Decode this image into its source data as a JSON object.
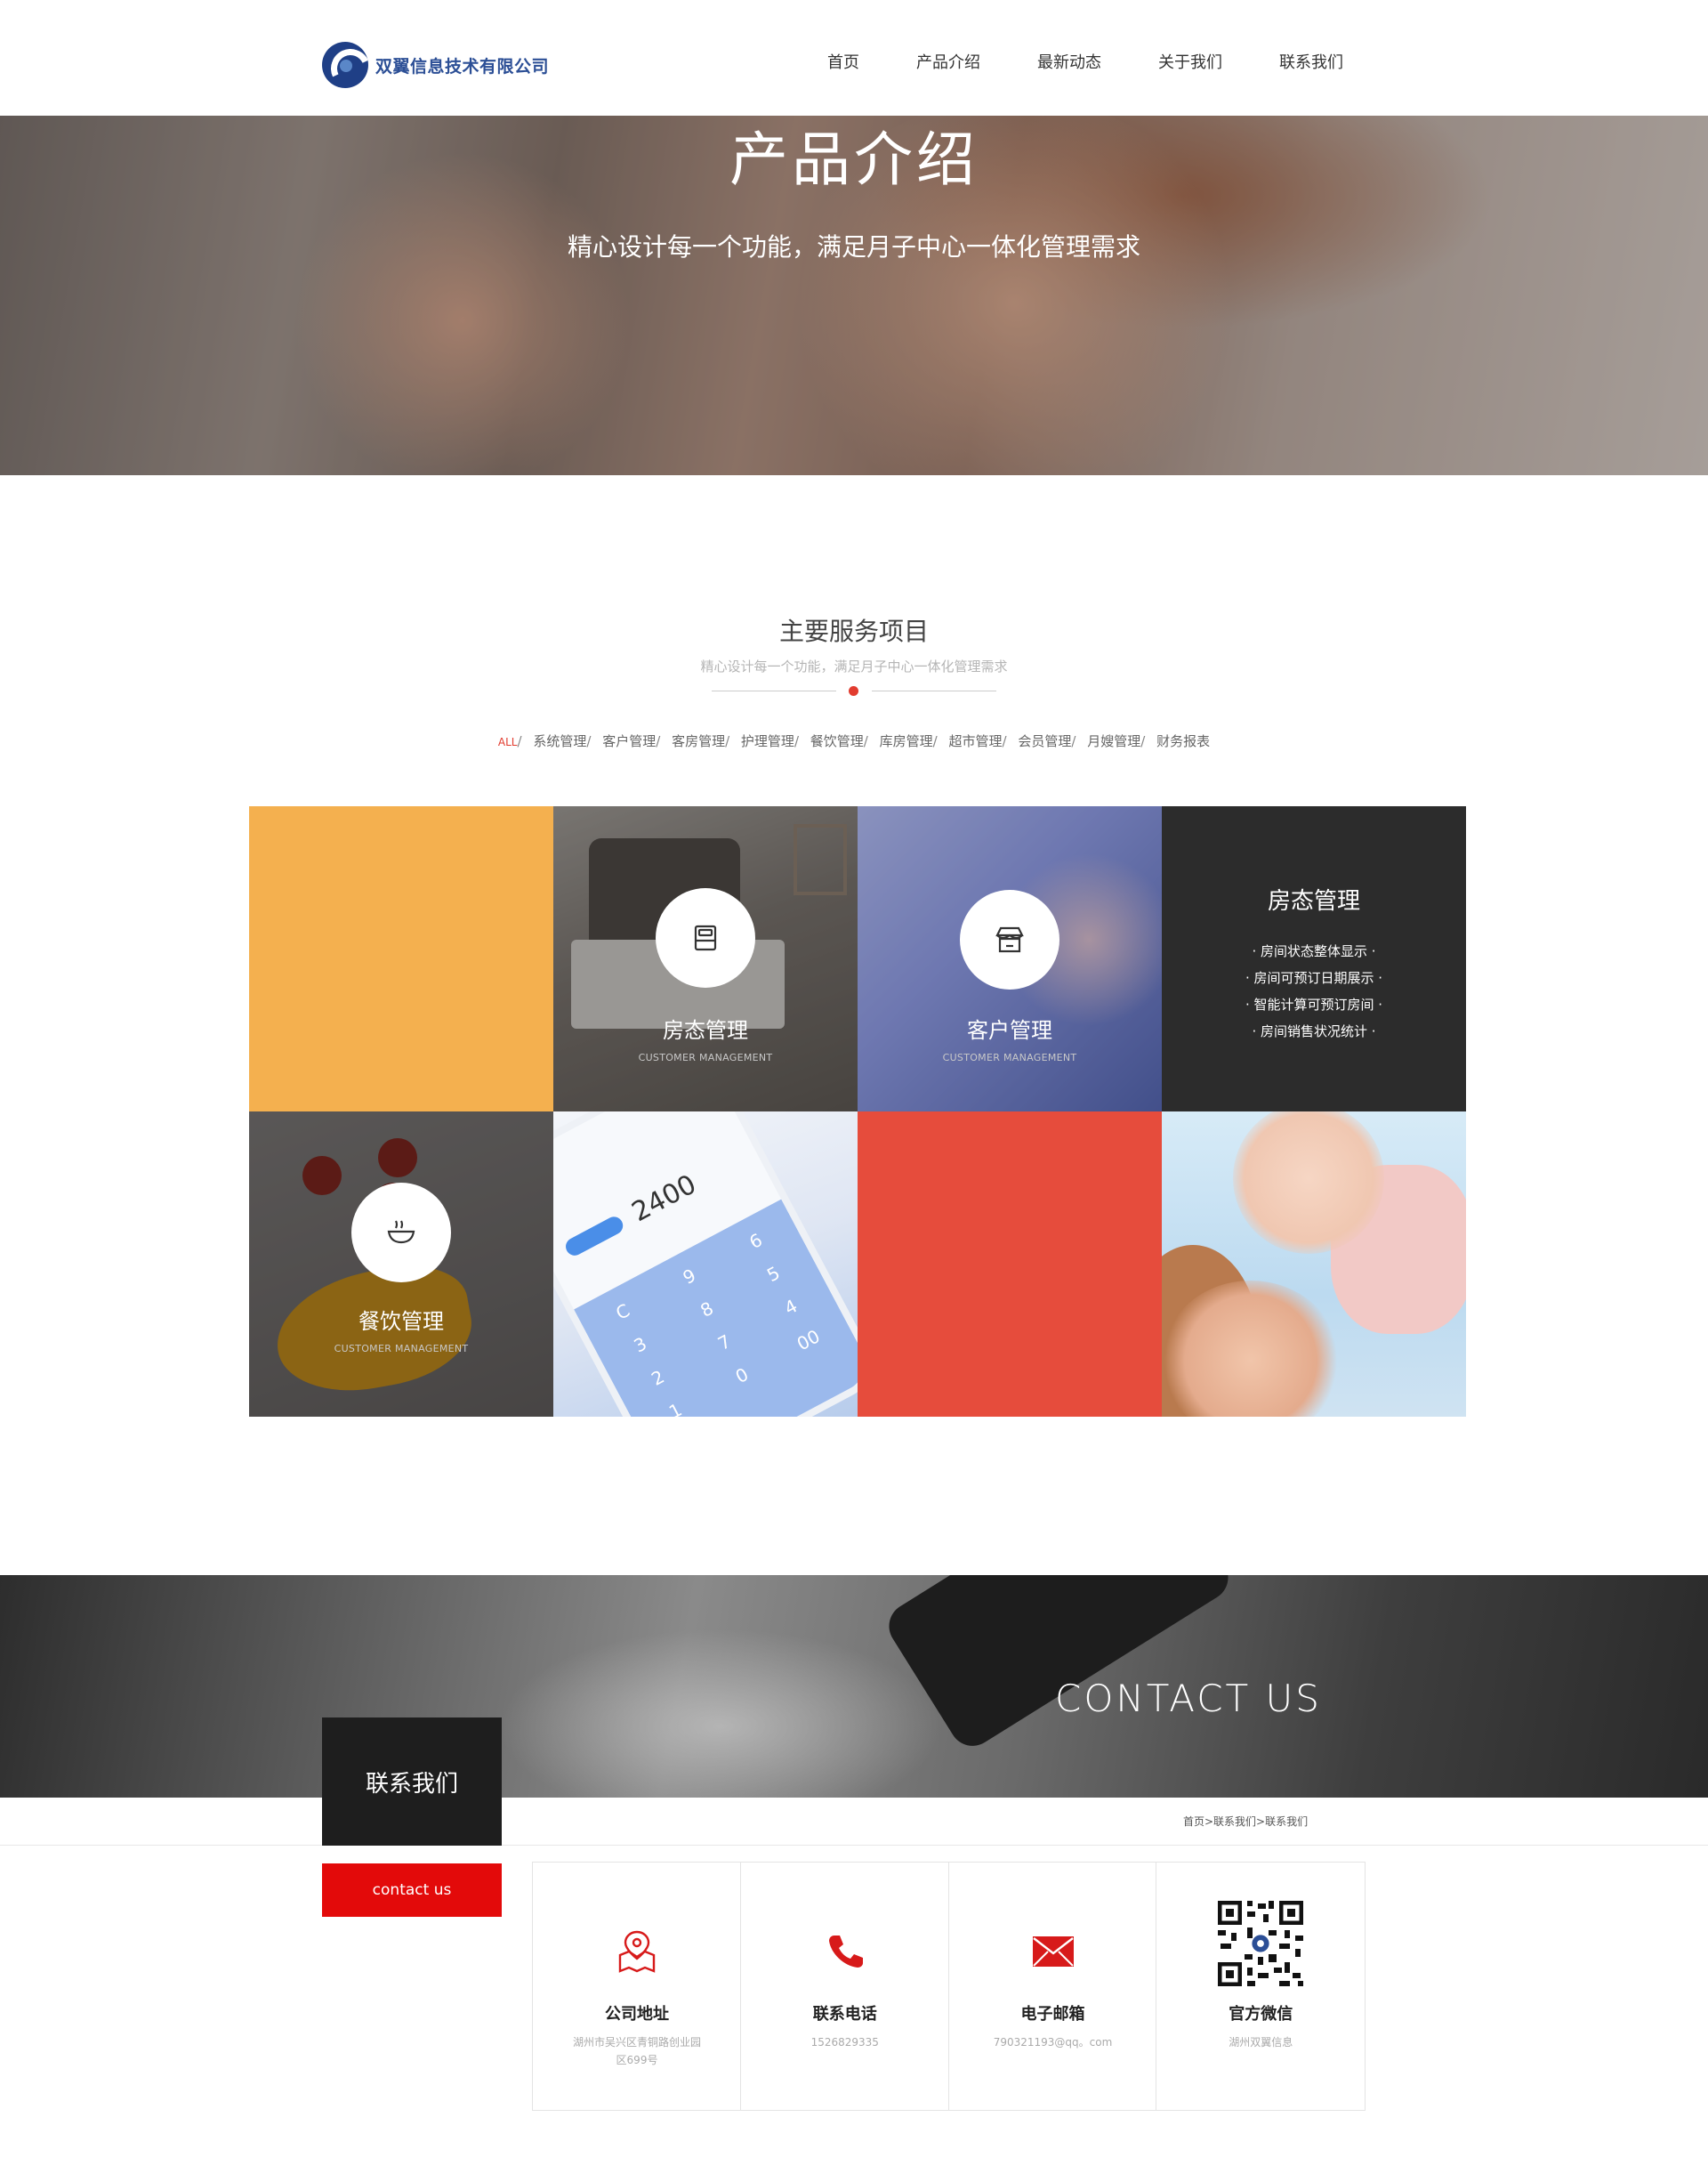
{
  "header": {
    "company_name": "双翼信息技术有限公司",
    "nav": [
      "首页",
      "产品介绍",
      "最新动态",
      "关于我们",
      "联系我们"
    ]
  },
  "banner": {
    "title": "产品介绍",
    "subtitle": "精心设计每一个功能，满足月子中心一体化管理需求"
  },
  "services": {
    "title": "主要服务项目",
    "subtitle": "精心设计每一个功能，满足月子中心一体化管理需求",
    "filters": [
      "ALL",
      "系统管理",
      "客户管理",
      "客房管理",
      "护理管理",
      "餐饮管理",
      "库房管理",
      "超市管理",
      "会员管理",
      "月嫂管理",
      "财务报表"
    ],
    "active_filter": "ALL",
    "tiles": {
      "bed": {
        "title": "房态管理",
        "subtitle": "CUSTOMER MANAGEMENT",
        "icon": "bed-icon"
      },
      "customer": {
        "title": "客户管理",
        "subtitle": "CUSTOMER MANAGEMENT",
        "icon": "store-icon"
      },
      "room_status": {
        "title": "房态管理",
        "features": [
          "· 房间状态整体显示 ·",
          "· 房间可预订日期展示 ·",
          "· 智能计算可预订房间 ·",
          "· 房间销售状况统计 ·"
        ]
      },
      "food": {
        "title": "餐饮管理",
        "subtitle": "CUSTOMER MANAGEMENT",
        "icon": "bowl-icon"
      },
      "phone": {
        "amount": "2400",
        "keys": [
          "C",
          "9",
          "6",
          "3",
          "8",
          "5",
          "2",
          "7",
          "4",
          "1",
          "0",
          "00"
        ]
      }
    },
    "colors": {
      "orange": "#f4b04f",
      "red": "#e64c3c",
      "dark": "#2c2c2c",
      "accent": "#e23c2f"
    }
  },
  "contact": {
    "banner_en": "CONTACT US",
    "box_title": "联系我们",
    "box_sub": "contact us",
    "breadcrumb": "首页>联系我们>联系我们",
    "cards": [
      {
        "title": "公司地址",
        "value": "湖州市吴兴区青铜路创业园区699号",
        "icon": "map-pin-icon"
      },
      {
        "title": "联系电话",
        "value": "1526829335",
        "icon": "phone-icon"
      },
      {
        "title": "电子邮箱",
        "value": "790321193@qq。com",
        "icon": "mail-icon"
      },
      {
        "title": "官方微信",
        "value": "湖州双翼信息",
        "icon": "qr-code-icon"
      }
    ]
  }
}
